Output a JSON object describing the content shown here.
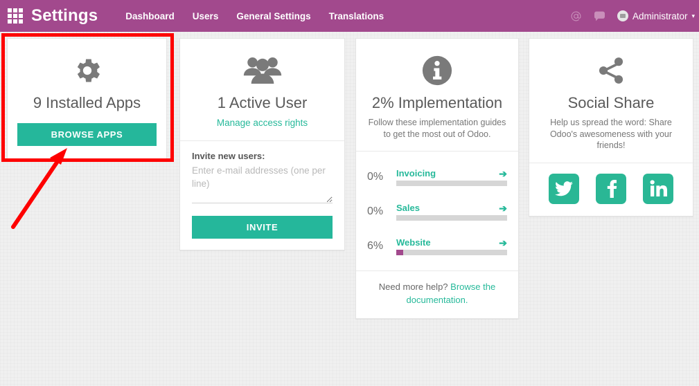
{
  "navbar": {
    "apps_icon": "apps-grid-icon",
    "brand": "Settings",
    "links": [
      {
        "label": "Dashboard"
      },
      {
        "label": "Users"
      },
      {
        "label": "General Settings"
      },
      {
        "label": "Translations"
      }
    ],
    "mention_icon": "at-sign-icon",
    "messages_icon": "chat-bubble-icon",
    "user_name": "Administrator",
    "caret": "▾",
    "bg_color": "#a2498d"
  },
  "cards": {
    "apps": {
      "icon": "gear-icon",
      "title": "9 Installed Apps",
      "button_label": "BROWSE APPS"
    },
    "users": {
      "icon": "users-group-icon",
      "title": "1 Active User",
      "manage_link": "Manage access rights",
      "invite_label": "Invite new users:",
      "invite_placeholder": "Enter e-mail addresses (one per line)",
      "invite_value": "",
      "invite_button": "INVITE"
    },
    "implementation": {
      "icon": "info-circle-icon",
      "title": "2% Implementation",
      "subtitle": "Follow these implementation guides to get the most out of Odoo.",
      "help_prefix": "Need more help?",
      "help_link": "Browse the documentation.",
      "progress": [
        {
          "percent_label": "0%",
          "percent": 0,
          "name": "Invoicing",
          "arrow": "➔"
        },
        {
          "percent_label": "0%",
          "percent": 0,
          "name": "Sales",
          "arrow": "➔"
        },
        {
          "percent_label": "6%",
          "percent": 6,
          "name": "Website",
          "arrow": "➔"
        }
      ]
    },
    "social": {
      "icon": "share-nodes-icon",
      "title": "Social Share",
      "subtitle": "Help us spread the word: Share Odoo's awesomeness with your friends!",
      "buttons": [
        {
          "name": "twitter"
        },
        {
          "name": "facebook"
        },
        {
          "name": "linkedin"
        }
      ]
    }
  },
  "annotations": {
    "highlight_color": "#fe0000",
    "box_target": "apps-card",
    "arrow_target": "browse-apps-button"
  },
  "colors": {
    "accent_teal": "#26b99a",
    "brand_purple": "#a2498d",
    "annotation_red": "#fe0000",
    "icon_gray": "#7a7a7a",
    "track_gray": "#d6d6d6"
  }
}
